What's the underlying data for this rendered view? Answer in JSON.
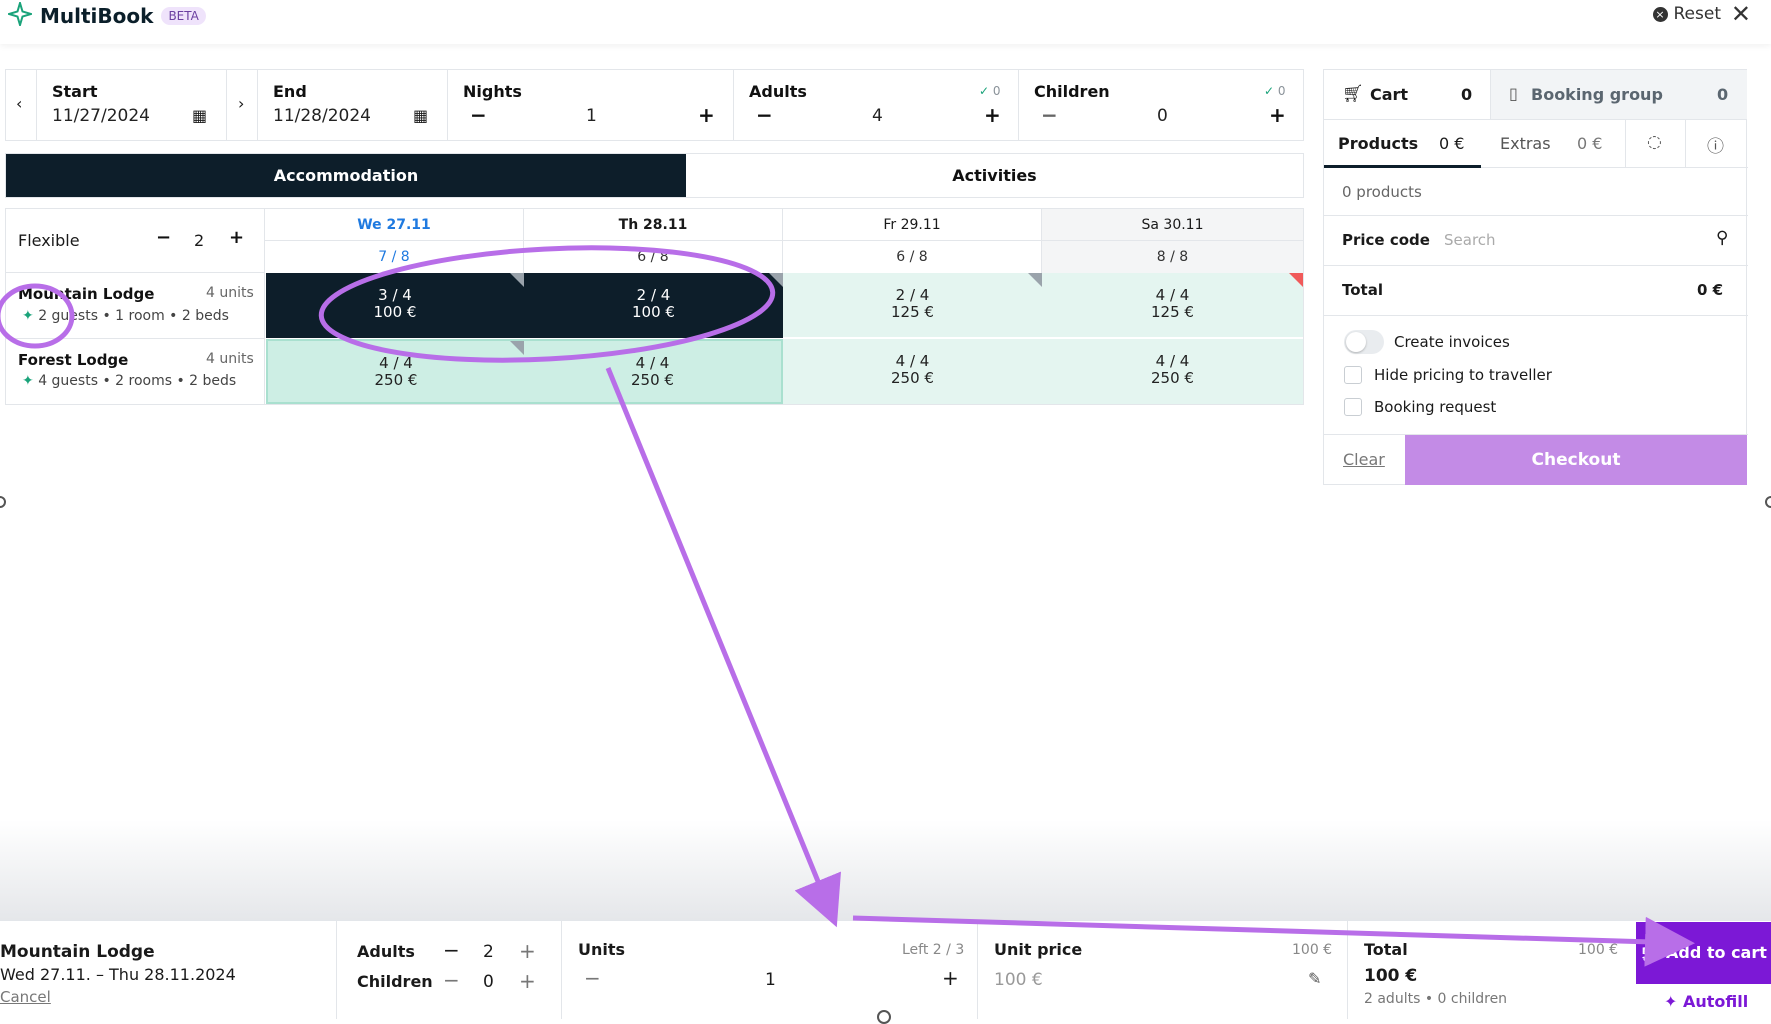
{
  "header": {
    "brand": "MultiBook",
    "badge": "BETA",
    "reset_label": "Reset"
  },
  "search": {
    "start_label": "Start",
    "start_value": "11/27/2024",
    "end_label": "End",
    "end_value": "11/28/2024",
    "nights_label": "Nights",
    "nights_value": "1",
    "adults_label": "Adults",
    "adults_value": "4",
    "adults_check": "0",
    "children_label": "Children",
    "children_value": "0",
    "children_check": "0"
  },
  "tabs": {
    "accommodation": "Accommodation",
    "activities": "Activities"
  },
  "calendar": {
    "flexible_label": "Flexible",
    "flexible_value": "2",
    "days": [
      {
        "label": "We 27.11",
        "occ": "7 / 8"
      },
      {
        "label": "Th 28.11",
        "occ": "6 / 8"
      },
      {
        "label": "Fr 29.11",
        "occ": "6 / 8"
      },
      {
        "label": "Sa 30.11",
        "occ": "8 / 8"
      }
    ],
    "rows": [
      {
        "name": "Mountain Lodge",
        "units": "4 units",
        "meta": "2 guests • 1 room • 2 beds",
        "cells": [
          {
            "avail": "3 / 4",
            "price": "100 €"
          },
          {
            "avail": "2 / 4",
            "price": "100 €"
          },
          {
            "avail": "2 / 4",
            "price": "125 €"
          },
          {
            "avail": "4 / 4",
            "price": "125 €"
          }
        ]
      },
      {
        "name": "Forest Lodge",
        "units": "4 units",
        "meta": "4 guests • 2 rooms • 2 beds",
        "cells": [
          {
            "avail": "4 / 4",
            "price": "250 €"
          },
          {
            "avail": "4 / 4",
            "price": "250 €"
          },
          {
            "avail": "4 / 4",
            "price": "250 €"
          },
          {
            "avail": "4 / 4",
            "price": "250 €"
          }
        ]
      }
    ]
  },
  "cart": {
    "cart_label": "Cart",
    "cart_count": "0",
    "group_label": "Booking group",
    "group_count": "0",
    "products_label": "Products",
    "products_value": "0 €",
    "extras_label": "Extras",
    "extras_value": "0 €",
    "products_count": "0 products",
    "price_code_label": "Price code",
    "price_code_placeholder": "Search",
    "total_label": "Total",
    "total_value": "0 €",
    "create_invoices": "Create invoices",
    "hide_pricing": "Hide pricing to traveller",
    "booking_request": "Booking request",
    "clear": "Clear",
    "checkout": "Checkout"
  },
  "selection": {
    "name": "Mountain Lodge",
    "dates": "Wed 27.11. – Thu 28.11.2024",
    "cancel": "Cancel",
    "adults_label": "Adults",
    "adults_value": "2",
    "children_label": "Children",
    "children_value": "0",
    "units_label": "Units",
    "units_left": "Left 2 / 3",
    "units_value": "1",
    "unit_price_label": "Unit price",
    "unit_price_ref": "100 €",
    "unit_price_value": "100 €",
    "total_label": "Total",
    "total_ref": "100 €",
    "total_value": "100 €",
    "total_meta": "2 adults • 0 children",
    "add_to_cart": "Add to cart",
    "autofill": "Autofill"
  },
  "colors": {
    "dark": "#0d1e2a",
    "accent": "#7c18d6",
    "checkout": "#c38be6",
    "cell_green": "#e4f5f0",
    "annotation": "#b86ee8"
  }
}
